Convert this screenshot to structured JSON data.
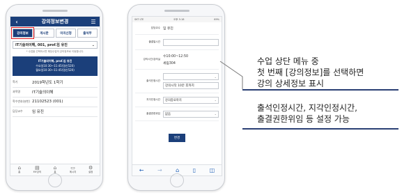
{
  "phone1": {
    "title": "강의정보변경",
    "back_icon": "‹",
    "menu_icon": "☰",
    "tabs": [
      "강의정보",
      "게시판",
      "이의신청",
      "출석부"
    ],
    "course_select": "IT기술의이해, 001, prof.임 유진",
    "note": "* 수업을 선택하시면 해당수업의 강의정보로 이동합니다.",
    "schedule": [
      "IT기술의이해, prof.임 유진",
      "수요일10:30~11:45(명신520)",
      "월요일10:30~11:45(명신520)"
    ],
    "rows": [
      {
        "k": "학기",
        "v": "2019학년도 1학기"
      },
      {
        "k": "과목명",
        "v": "IT기술의이해"
      },
      {
        "k": "학수번호(분반)",
        "v": "21102523 (001)"
      },
      {
        "k": "담당교수",
        "v": "임 유진"
      }
    ],
    "bottom_nav": [
      "홈",
      "MY강의",
      "홈",
      "메시지",
      "설정"
    ]
  },
  "phone2": {
    "status_left": "SKT LTE",
    "status_time": "오후 5:18",
    "status_right": "69%",
    "rows": {
      "professor_label": "담당교수",
      "professor_value": "임 유진",
      "time_label": "출결일시간",
      "time_value": "",
      "room_label": "강의시간/강의실",
      "room_value1": "수10:00~12:50",
      "room_value2": "세림304",
      "attend_label": "출석인정시간",
      "attend_value": "강의시작 10분 후까지",
      "late_label": "지각인정시간",
      "late_value": "강의종료까지",
      "delegate_label": "출결권한위임",
      "delegate_value": "없음"
    },
    "save_button": "변경"
  },
  "annotations": {
    "callout1_lines": [
      "수업 상단 메뉴 중",
      "첫 번째 [강의정보]를 선택하면",
      "강의 상세정보 표시"
    ],
    "callout2_lines": [
      "출석인정시간, 지각인정시간,",
      "출결권한위임 등 설정 가능"
    ]
  },
  "colors": {
    "brand": "#1b3f7a",
    "highlight": "#e0181f",
    "underline": "#2a3f74"
  }
}
